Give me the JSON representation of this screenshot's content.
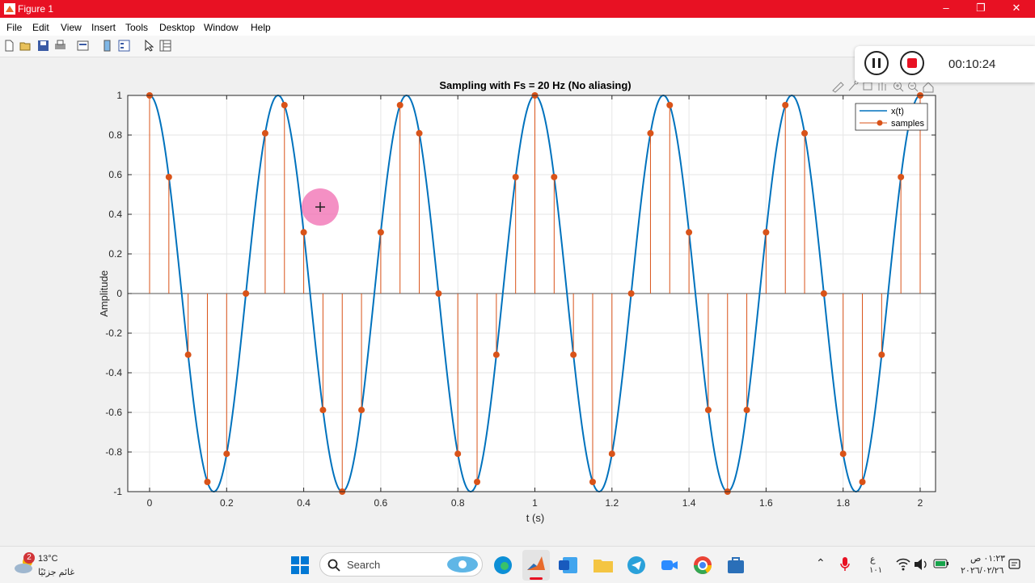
{
  "window": {
    "title": "Figure 1"
  },
  "menu": {
    "items": [
      "File",
      "Edit",
      "View",
      "Insert",
      "Tools",
      "Desktop",
      "Window",
      "Help"
    ]
  },
  "recorder": {
    "time": "00:10:24"
  },
  "chart_data": {
    "type": "line",
    "title": "Sampling with Fs = 20 Hz (No aliasing)",
    "xlabel": "t (s)",
    "ylabel": "Amplitude",
    "xlim": [
      0,
      2
    ],
    "ylim": [
      -1,
      1
    ],
    "grid": true,
    "legend_position": "top-right",
    "x_ticks": [
      "0",
      "0.2",
      "0.4",
      "0.6",
      "0.8",
      "1",
      "1.2",
      "1.4",
      "1.6",
      "1.8",
      "2"
    ],
    "y_ticks": [
      "-1",
      "-0.8",
      "-0.6",
      "-0.4",
      "-0.2",
      "0",
      "0.2",
      "0.4",
      "0.6",
      "0.8",
      "1"
    ],
    "series": [
      {
        "name": "x(t)",
        "style": "line",
        "color": "#0072bd",
        "function": "cos(2π·3·t)",
        "frequency_hz": 3
      },
      {
        "name": "samples",
        "style": "stem",
        "color": "#d95319",
        "sample_rate_hz": 20,
        "x": [
          0,
          0.05,
          0.1,
          0.15,
          0.2,
          0.25,
          0.3,
          0.35,
          0.4,
          0.45,
          0.5,
          0.55,
          0.6,
          0.65,
          0.7,
          0.75,
          0.8,
          0.85,
          0.9,
          0.95,
          1,
          1.05,
          1.1,
          1.15,
          1.2,
          1.25,
          1.3,
          1.35,
          1.4,
          1.45,
          1.5,
          1.55,
          1.6,
          1.65,
          1.7,
          1.75,
          1.8,
          1.85,
          1.9,
          1.95,
          2
        ],
        "y": [
          1,
          0.588,
          -0.309,
          -0.951,
          -0.809,
          0,
          0.809,
          0.951,
          0.309,
          -0.588,
          -1,
          -0.588,
          0.309,
          0.951,
          0.809,
          0,
          -0.809,
          -0.951,
          -0.309,
          0.588,
          1,
          0.588,
          -0.309,
          -0.951,
          -0.809,
          0,
          0.809,
          0.951,
          0.309,
          -0.588,
          -1,
          -0.588,
          0.309,
          0.951,
          0.809,
          0,
          -0.809,
          -0.951,
          -0.309,
          0.588,
          1
        ]
      }
    ]
  },
  "taskbar": {
    "weather_badge": "2",
    "weather_temp": "13°C",
    "weather_desc": "غائم جزئيًا",
    "search_label": "Search",
    "lang_top": "ع",
    "lang_bottom": "١٠١",
    "clock_time": "٠١:٢٣ ص",
    "clock_date": "٢٠٢٦/٠٢/٢٦"
  }
}
